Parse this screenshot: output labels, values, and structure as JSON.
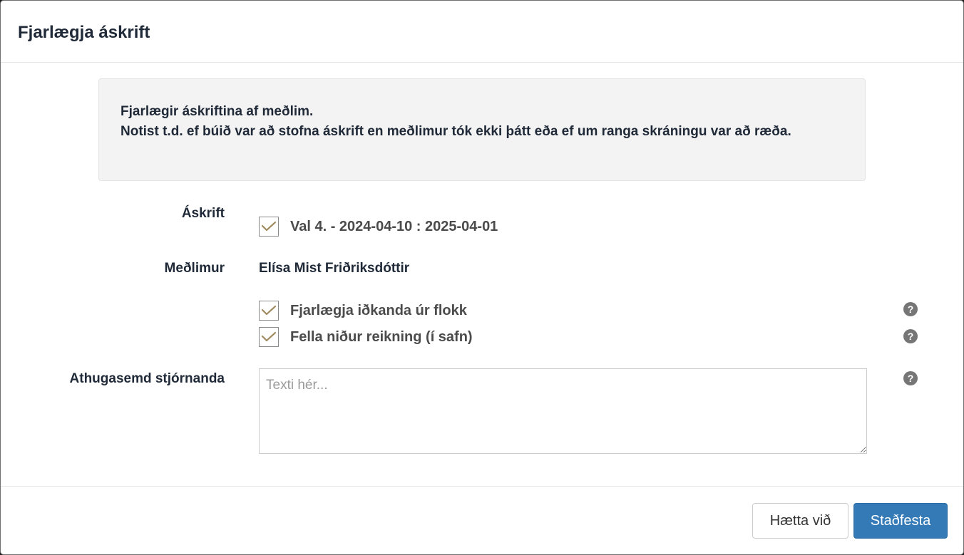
{
  "modal": {
    "title": "Fjarlægja áskrift"
  },
  "info": {
    "line1": "Fjarlægir áskriftina af meðlim.",
    "line2": "Notist t.d. ef búið var að stofna áskrift en meðlimur tók ekki þátt eða ef um ranga skráningu var að ræða."
  },
  "form": {
    "subscription_label": "Áskrift",
    "subscription_value": "Val 4. - 2024-04-10 : 2025-04-01",
    "subscription_checked": true,
    "member_label": "Meðlimur",
    "member_value": "Elísa Mist Friðriksdóttir",
    "options": [
      {
        "label": "Fjarlægja iðkanda úr flokk",
        "checked": true
      },
      {
        "label": "Fella niður reikning (í safn)",
        "checked": true
      }
    ],
    "comment_label": "Athugasemd stjórnanda",
    "comment_placeholder": "Texti hér...",
    "comment_value": ""
  },
  "footer": {
    "cancel_label": "Hætta við",
    "confirm_label": "Staðfesta"
  },
  "colors": {
    "checkmark": "#a08a5f",
    "primary": "#337ab7"
  },
  "icons": {
    "help": "question-circle-icon",
    "check": "check-icon"
  }
}
